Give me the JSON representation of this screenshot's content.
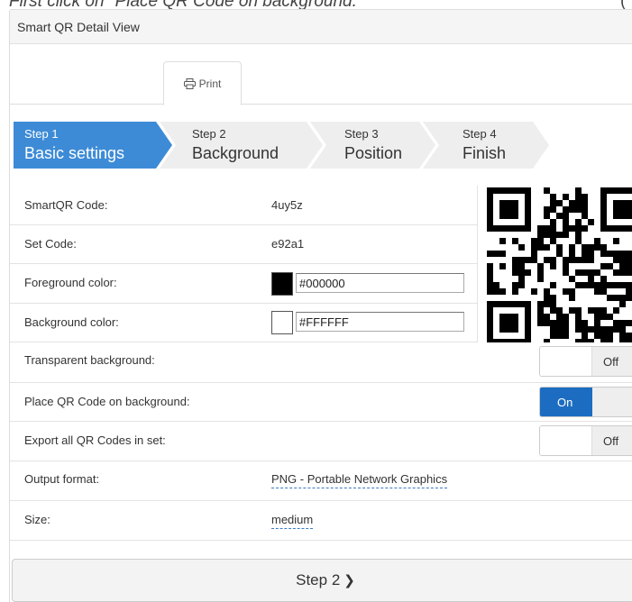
{
  "caption": {
    "text": "First click on \"Place QR Code on background.\"",
    "right": "("
  },
  "panel": {
    "title": "Smart QR Detail View"
  },
  "tabs": {
    "print_label": "Print",
    "print_icon": "printer-icon"
  },
  "wizard": {
    "steps": [
      {
        "num": "Step 1",
        "label": "Basic settings",
        "active": true
      },
      {
        "num": "Step 2",
        "label": "Background",
        "active": false
      },
      {
        "num": "Step 3",
        "label": "Position",
        "active": false
      },
      {
        "num": "Step 4",
        "label": "Finish",
        "active": false
      }
    ],
    "active_color": "#3d8bd6",
    "inactive_color": "#eeeeee"
  },
  "fields": {
    "smartqr_code": {
      "label": "SmartQR Code:",
      "value": "4uy5z"
    },
    "set_code": {
      "label": "Set Code:",
      "value": "e92a1"
    },
    "foreground": {
      "label": "Foreground color:",
      "value": "#000000",
      "swatch": "#000000"
    },
    "background": {
      "label": "Background color:",
      "value": "#FFFFFF",
      "swatch": "#FFFFFF"
    },
    "transparent": {
      "label": "Transparent background:",
      "state": "Off"
    },
    "place_on_bg": {
      "label": "Place QR Code on background:",
      "state": "On"
    },
    "export_all": {
      "label": "Export all QR Codes in set:",
      "state": "Off"
    },
    "output_format": {
      "label": "Output format:",
      "value": "PNG - Portable Network Graphics"
    },
    "size": {
      "label": "Size:",
      "value": "medium"
    }
  },
  "footer": {
    "next_label": "Step 2",
    "next_icon": "chevron-right-icon"
  },
  "colors": {
    "accent": "#1c6dc1",
    "link": "#3a7cc4"
  }
}
